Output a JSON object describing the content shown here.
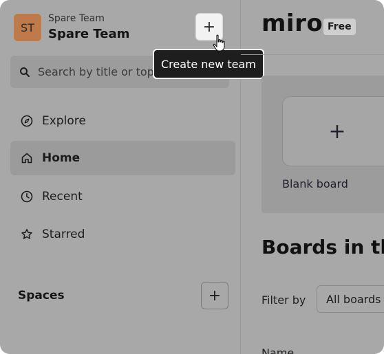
{
  "team": {
    "avatar_initials": "ST",
    "avatar_color": "#bf7a4c",
    "subtitle": "Spare Team",
    "name": "Spare Team",
    "add_button_label": "+",
    "tooltip": "Create new team"
  },
  "search": {
    "placeholder": "Search by title or topic",
    "icon": "search-icon"
  },
  "nav": {
    "items": [
      {
        "label": "Explore",
        "icon": "compass-icon",
        "active": false
      },
      {
        "label": "Home",
        "icon": "home-icon",
        "active": true
      },
      {
        "label": "Recent",
        "icon": "clock-icon",
        "active": false
      },
      {
        "label": "Starred",
        "icon": "star-icon",
        "active": false
      }
    ]
  },
  "spaces": {
    "label": "Spaces",
    "add_button_label": "+"
  },
  "header": {
    "logo": "miro",
    "plan_badge": "Free"
  },
  "main": {
    "blank_board": {
      "icon_label": "+",
      "label": "Blank board"
    },
    "boards_heading": "Boards in this team",
    "filter": {
      "label": "Filter by",
      "value": "All boards"
    },
    "table": {
      "columns": [
        "Name"
      ]
    }
  }
}
